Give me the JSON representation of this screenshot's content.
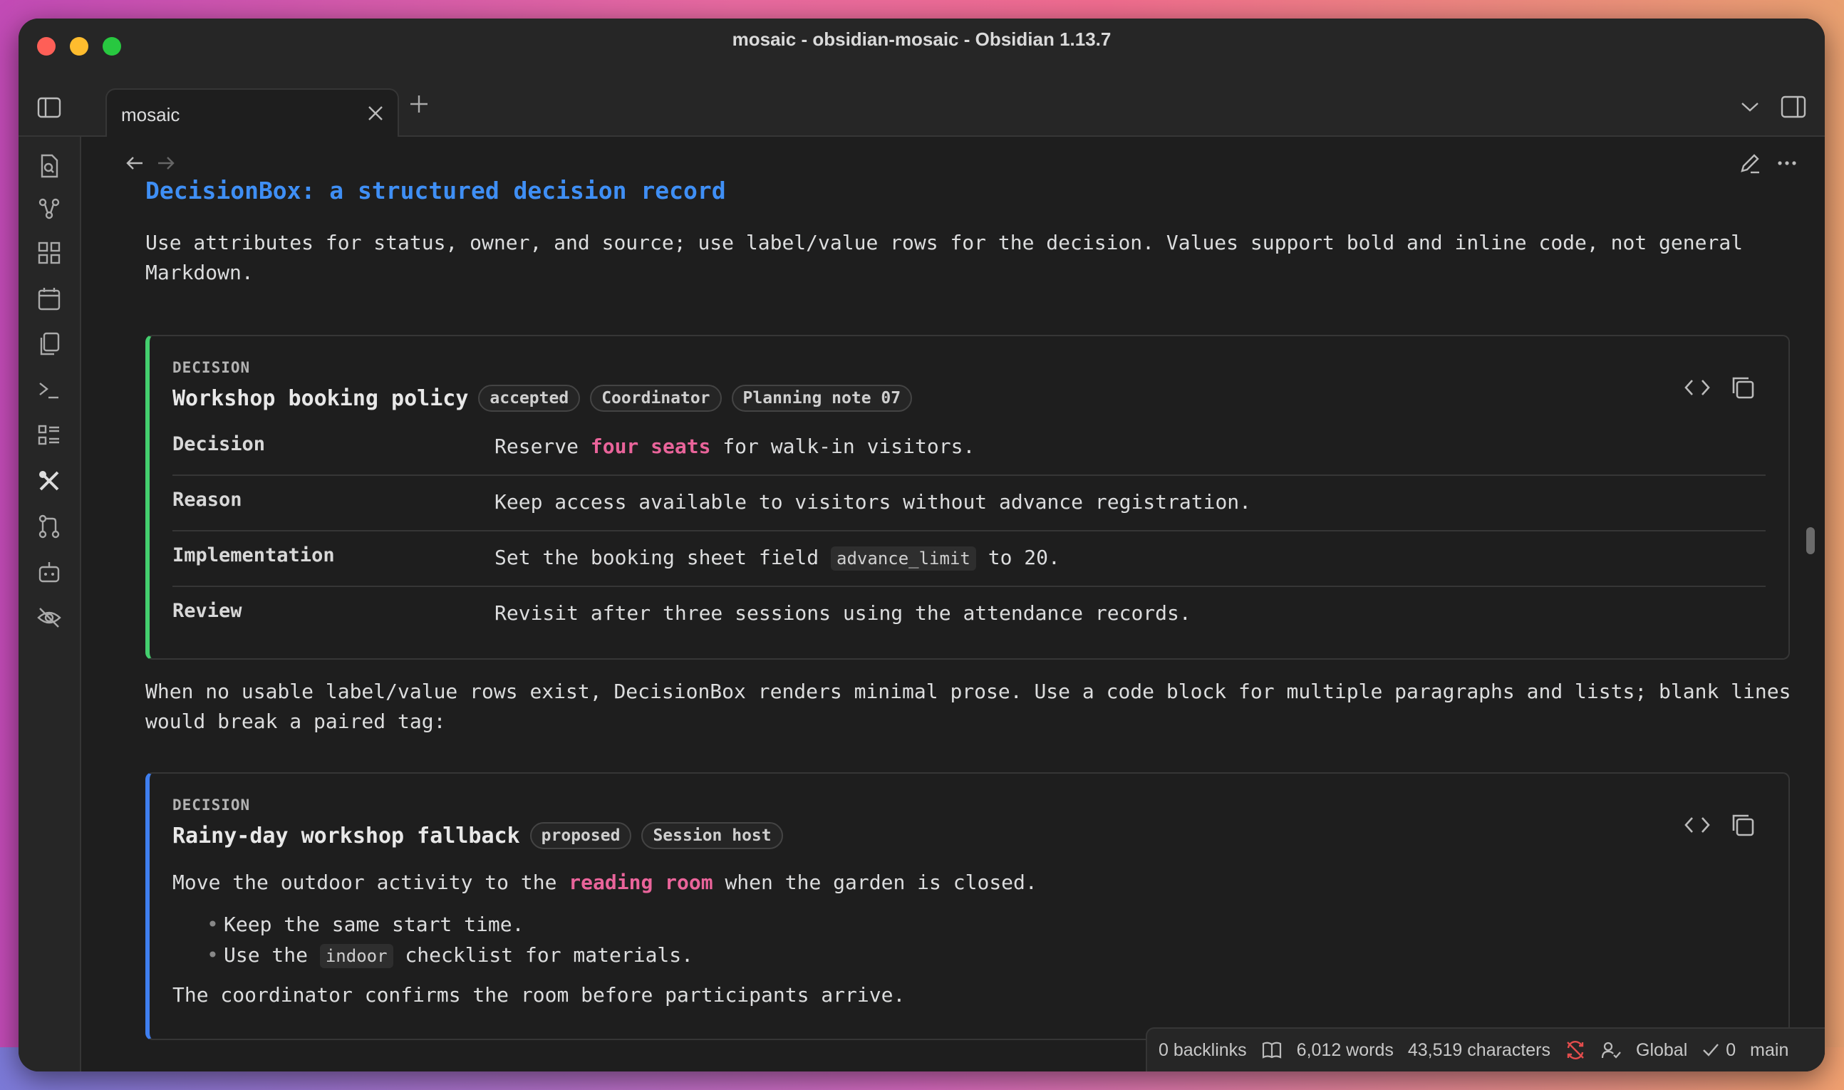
{
  "window": {
    "title": "mosaic - obsidian-mosaic - Obsidian 1.13.7"
  },
  "tabs": [
    {
      "label": "mosaic"
    }
  ],
  "ribbon": {
    "icons": [
      "search-file-icon",
      "graph-icon",
      "grid-icon",
      "calendar-icon",
      "copy-icon",
      "terminal-icon",
      "list-icon",
      "tools-icon",
      "git-branch-icon",
      "bot-icon",
      "eye-off-icon"
    ]
  },
  "doc": {
    "heading": "DecisionBox: a structured decision record",
    "intro": "Use attributes for status, owner, and source; use label/value rows for the decision. Values support bold and inline code, not general Markdown.",
    "box1": {
      "eyebrow": "DECISION",
      "title": "Workshop booking policy",
      "chips": [
        "accepted",
        "Coordinator",
        "Planning note 07"
      ],
      "rows": [
        {
          "label": "Decision",
          "pre": "Reserve ",
          "highlight": "four seats",
          "post": " for walk-in visitors."
        },
        {
          "label": "Reason",
          "value": "Keep access available to visitors without advance registration."
        },
        {
          "label": "Implementation",
          "pre": "Set the booking sheet field ",
          "code": "advance_limit",
          "post": " to 20."
        },
        {
          "label": "Review",
          "value": "Revisit after three sessions using the attendance records."
        }
      ]
    },
    "middle": "When no usable label/value rows exist, DecisionBox renders minimal prose. Use a code block for multiple paragraphs and lists; blank lines would break a paired tag:",
    "box2": {
      "eyebrow": "DECISION",
      "title": "Rainy-day workshop fallback",
      "chips": [
        "proposed",
        "Session host"
      ],
      "line1_pre": "Move the outdoor activity to the ",
      "line1_highlight": "reading room",
      "line1_post": " when the garden is closed.",
      "bullet1": "Keep the same start time.",
      "bullet2_pre": "Use the ",
      "bullet2_code": "indoor",
      "bullet2_post": " checklist for materials.",
      "closing": "The coordinator confirms the room before participants arrive."
    }
  },
  "status": {
    "backlinks": "0 backlinks",
    "words": "6,012 words",
    "characters": "43,519 characters",
    "scope": "Global",
    "checks": "0",
    "branch": "main"
  },
  "colors": {
    "accent": "#3f8ff5",
    "highlight": "#e9649a",
    "accepted": "#44cf6e",
    "proposed": "#3f7ff0"
  }
}
